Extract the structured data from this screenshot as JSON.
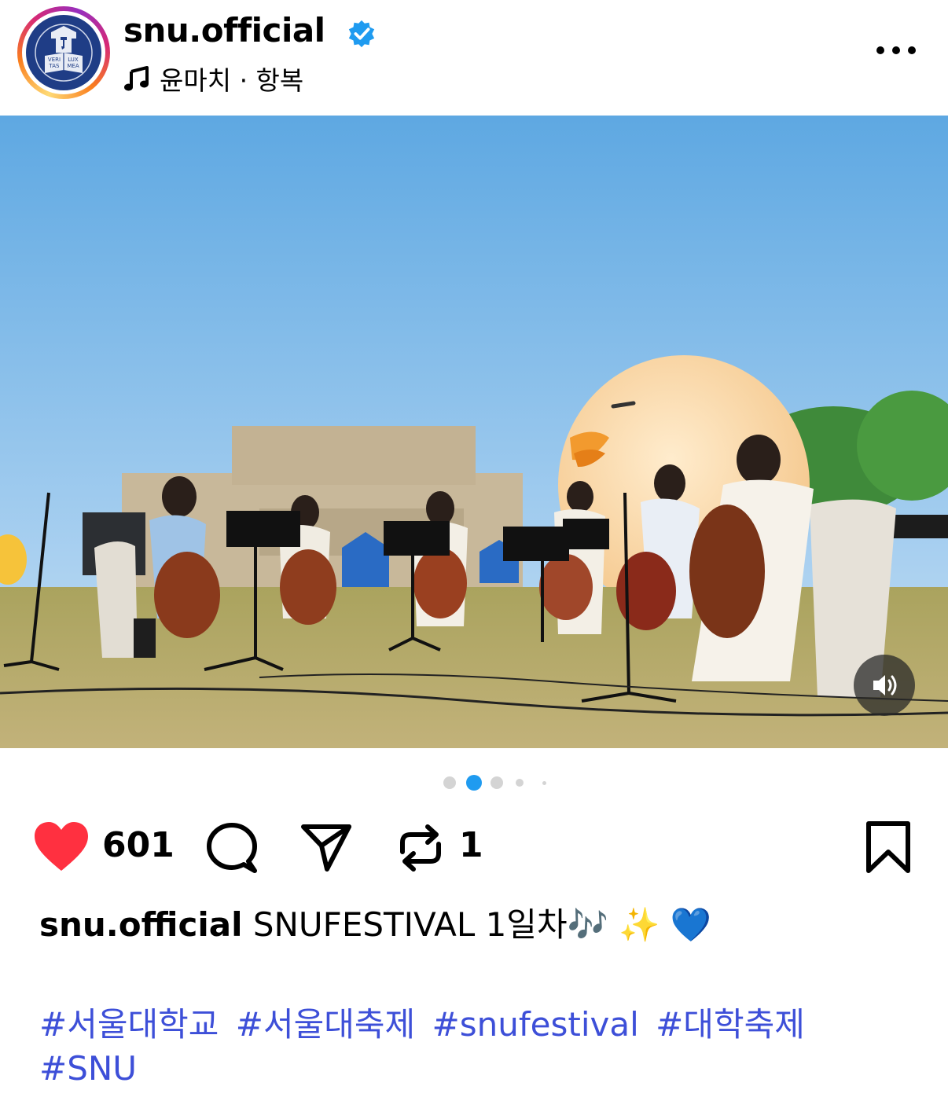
{
  "post": {
    "username": "snu.official",
    "music": "윤마치 · 항복",
    "avatar_motto": [
      "VERI",
      "LUX",
      "TAS",
      "MEA"
    ]
  },
  "carousel": {
    "total_dots": 5,
    "active_index": 1
  },
  "actions": {
    "like_count": "601",
    "repost_count": "1"
  },
  "caption": {
    "username": "snu.official",
    "text": "SNUFESTIVAL 1일차🎶 ✨ 💙"
  },
  "hashtags": [
    "#서울대학교",
    "#서울대축제",
    "#snufestival",
    "#대학축제",
    "#SNU"
  ],
  "colors": {
    "like": "#ff3040",
    "hashtag": "#3d4fd8",
    "verified": "#1f9bf0",
    "sky_top": "#5ea8e2",
    "grass": "#b9ab6a"
  }
}
